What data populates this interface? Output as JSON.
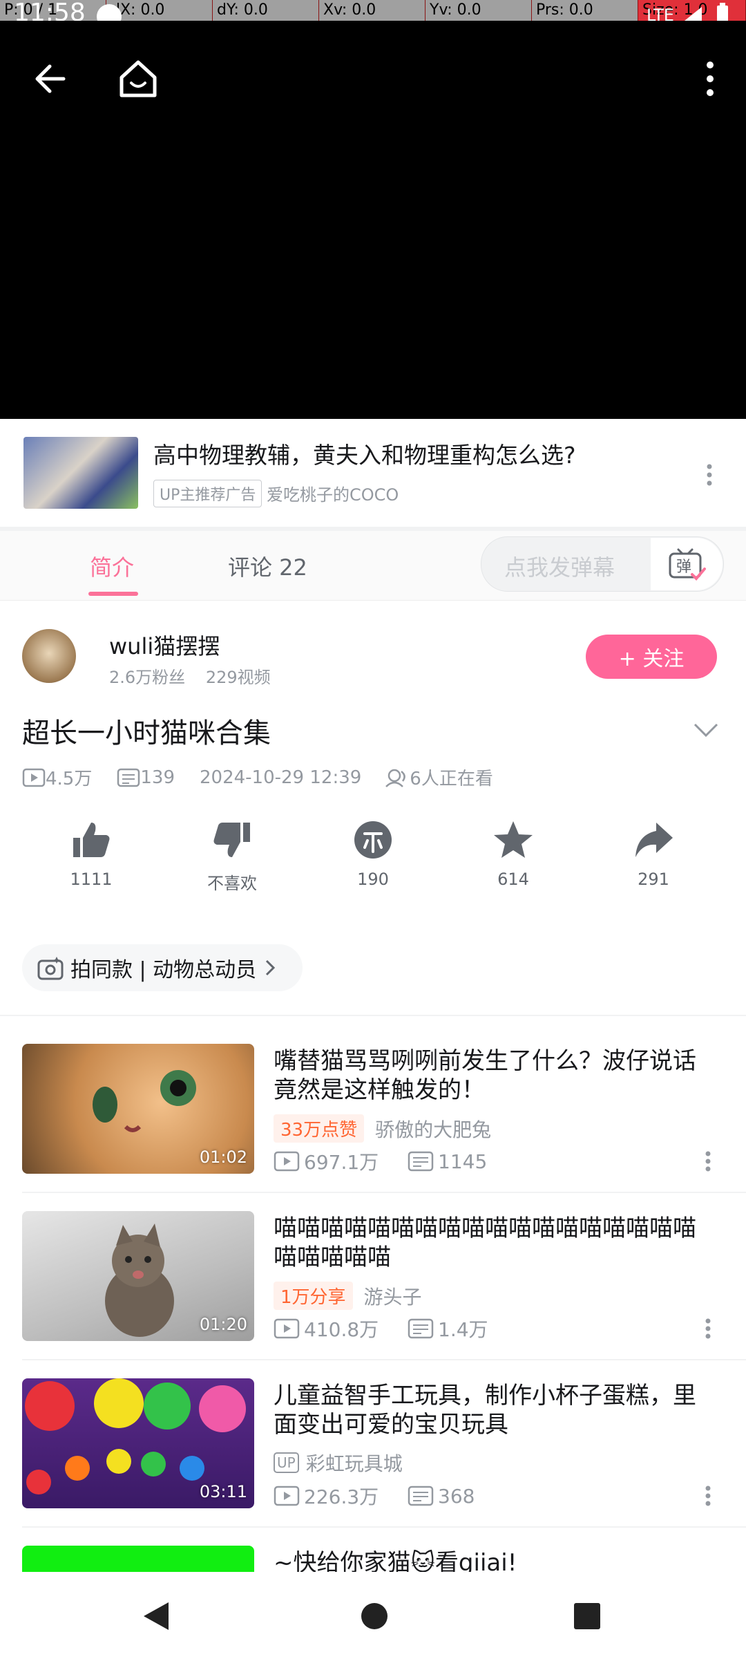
{
  "debug": {
    "p": "P: 0 / 1",
    "dx": "dX: 0.0",
    "dy": "dY: 0.0",
    "xv": "Xv: 0.0",
    "yv": "Yv: 0.0",
    "prs": "Prs: 0.0",
    "size": "Size: 1.0"
  },
  "status": {
    "time": "11:58",
    "net": "LTE"
  },
  "ad": {
    "title": "高中物理教辅，黄夫入和物理重构怎么选?",
    "badge": "UP主推荐广告",
    "author": "爱吃桃子的COCO"
  },
  "tabs": {
    "intro": "简介",
    "comments": "评论 22"
  },
  "danmaku": {
    "placeholder": "点我发弹幕",
    "btn_char": "弹"
  },
  "uploader": {
    "name": "wuli猫摆摆",
    "fans": "2.6万粉丝",
    "videos": "229视频",
    "follow": "+ 关注"
  },
  "video": {
    "title": "超长一小时猫咪合集",
    "views": "4.5万",
    "danmaku": "139",
    "date": "2024-10-29 12:39",
    "watching": "6人正在看"
  },
  "actions": {
    "like": "1111",
    "dislike": "不喜欢",
    "coin": "190",
    "favorite": "614",
    "share": "291"
  },
  "collection": {
    "label": "拍同款 | 动物总动员"
  },
  "related": [
    {
      "title": "嘴替猫骂骂咧咧前发生了什么？波仔说话竟然是这样触发的！",
      "tag": "33万点赞",
      "author": "骄傲的大肥兔",
      "views": "697.1万",
      "danmaku": "1145",
      "duration": "01:02"
    },
    {
      "title": "喵喵喵喵喵喵喵喵喵喵喵喵喵喵喵喵喵喵喵喵喵喵喵",
      "tag": "1万分享",
      "author": "游头子",
      "views": "410.8万",
      "danmaku": "1.4万",
      "duration": "01:20"
    },
    {
      "title": "儿童益智手工玩具，制作小杯子蛋糕，里面变出可爱的宝贝玩具",
      "up_badge": "UP",
      "author": "彩虹玩具城",
      "views": "226.3万",
      "danmaku": "368",
      "duration": "03:11"
    },
    {
      "title": "~快给你家猫🐱看giiai!"
    }
  ]
}
